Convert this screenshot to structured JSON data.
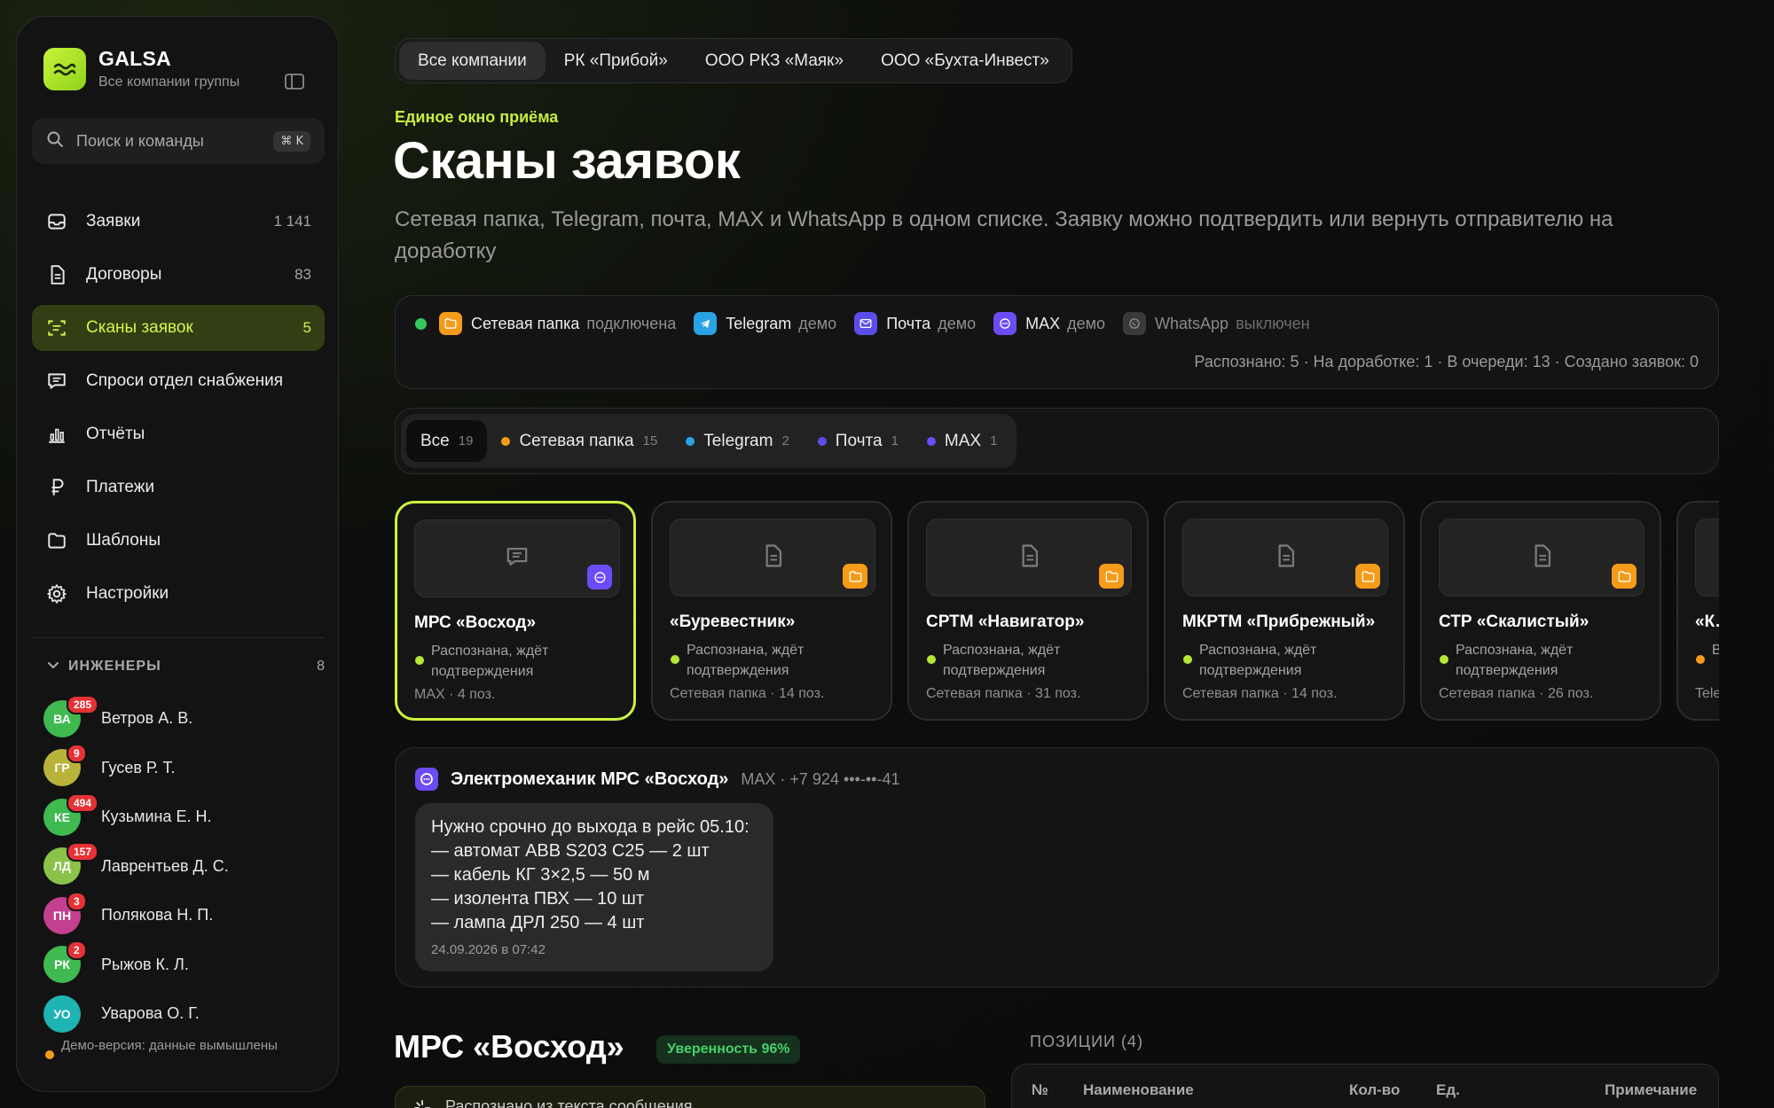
{
  "sidebar": {
    "brand_name": "GALSA",
    "brand_subtitle": "Все компании группы",
    "search_placeholder": "Поиск и команды",
    "search_shortcut": "⌘ K",
    "nav": [
      {
        "label": "Заявки",
        "count": "1 141",
        "icon": "inbox-icon"
      },
      {
        "label": "Договоры",
        "count": "83",
        "icon": "document-icon"
      },
      {
        "label": "Сканы заявок",
        "count": "5",
        "icon": "scan-icon",
        "active": true
      },
      {
        "label": "Спроси отдел снабжения",
        "count": "",
        "icon": "chat-icon"
      },
      {
        "label": "Отчёты",
        "count": "",
        "icon": "bar-chart-icon"
      },
      {
        "label": "Платежи",
        "count": "",
        "icon": "ruble-icon"
      },
      {
        "label": "Шаблоны",
        "count": "",
        "icon": "folder-icon"
      },
      {
        "label": "Настройки",
        "count": "",
        "icon": "gear-icon"
      }
    ],
    "engineers_title": "ИНЖЕНЕРЫ",
    "engineers_count": "8",
    "engineers": [
      {
        "initials": "ВА",
        "name": "Ветров А. В.",
        "badge": "285",
        "color": "#3fb950"
      },
      {
        "initials": "ГР",
        "name": "Гусев Р. Т.",
        "badge": "9",
        "color": "#b9b33a"
      },
      {
        "initials": "КЕ",
        "name": "Кузьмина Е. Н.",
        "badge": "494",
        "color": "#3fb950"
      },
      {
        "initials": "ЛД",
        "name": "Лаврентьев Д. С.",
        "badge": "157",
        "color": "#8bc34a"
      },
      {
        "initials": "ПН",
        "name": "Полякова Н. П.",
        "badge": "3",
        "color": "#c2408f"
      },
      {
        "initials": "РК",
        "name": "Рыжов К. Л.",
        "badge": "2",
        "color": "#3fb950"
      },
      {
        "initials": "УО",
        "name": "Уварова О. Г.",
        "badge": "",
        "color": "#1fb3b3"
      }
    ],
    "demo_note": "Демо-версия: данные вымышлены"
  },
  "company_tabs": [
    "Все компании",
    "РК «Прибой»",
    "ООО РКЗ «Маяк»",
    "ООО «Бухта-Инвест»"
  ],
  "header": {
    "eyebrow": "Единое окно приёма",
    "title": "Сканы заявок",
    "description": "Сетевая папка, Telegram, почта, MAX и WhatsApp в одном списке. Заявку можно подтвердить или вернуть отправителю на доработку"
  },
  "channels": [
    {
      "name": "Сетевая папка",
      "status": "подключена",
      "color": "#f59b1a",
      "icon": "folder-icon"
    },
    {
      "name": "Telegram",
      "status": "демо",
      "color": "#2aa3e6",
      "icon": "telegram-icon"
    },
    {
      "name": "Почта",
      "status": "демо",
      "color": "#5b4ee8",
      "icon": "mail-icon"
    },
    {
      "name": "MAX",
      "status": "демо",
      "color": "#6b4cf6",
      "icon": "max-icon"
    },
    {
      "name": "WhatsApp",
      "status": "выключен",
      "color": "#3a3a3a",
      "icon": "whatsapp-icon",
      "off": true
    }
  ],
  "stats": "Распознано: 5 · На доработке: 1 · В очереди: 13 · Создано заявок: 0",
  "filters": [
    {
      "label": "Все",
      "count": "19",
      "dot": ""
    },
    {
      "label": "Сетевая папка",
      "count": "15",
      "dot": "#f59b1a"
    },
    {
      "label": "Telegram",
      "count": "2",
      "dot": "#2aa3e6"
    },
    {
      "label": "Почта",
      "count": "1",
      "dot": "#5b4ee8"
    },
    {
      "label": "MAX",
      "count": "1",
      "dot": "#6b4cf6"
    }
  ],
  "cards": [
    {
      "title": "МРС «Восход»",
      "status": "Распознана, ждёт подтверждения",
      "meta": "MAX · 4 поз.",
      "thumb_icon": "chat-icon",
      "source_icon": "max-icon",
      "source_color": "#6b4cf6",
      "status_color": "#b5e835",
      "selected": true
    },
    {
      "title": "«Буревестник»",
      "status": "Распознана, ждёт подтверждения",
      "meta": "Сетевая папка · 14 поз.",
      "thumb_icon": "document-icon",
      "source_icon": "folder-icon",
      "source_color": "#f59b1a",
      "status_color": "#b5e835"
    },
    {
      "title": "СРТМ «Навигатор»",
      "status": "Распознана, ждёт подтверждения",
      "meta": "Сетевая папка · 31 поз.",
      "thumb_icon": "document-icon",
      "source_icon": "folder-icon",
      "source_color": "#f59b1a",
      "status_color": "#b5e835"
    },
    {
      "title": "МКРТМ «Прибрежный»",
      "status": "Распознана, ждёт подтверждения",
      "meta": "Сетевая папка · 14 поз.",
      "thumb_icon": "document-icon",
      "source_icon": "folder-icon",
      "source_color": "#f59b1a",
      "status_color": "#b5e835"
    },
    {
      "title": "СТР «Скалистый»",
      "status": "Распознана, ждёт подтверждения",
      "meta": "Сетевая папка · 26 поз.",
      "thumb_icon": "document-icon",
      "source_icon": "folder-icon",
      "source_color": "#f59b1a",
      "status_color": "#b5e835"
    },
    {
      "title": "«К…",
      "status": "В… д…",
      "meta": "Tele…",
      "thumb_icon": "document-icon",
      "source_icon": "",
      "source_color": "",
      "status_color": "#f59b1a"
    }
  ],
  "message": {
    "sender": "Электромеханик МРС «Восход»",
    "meta": "MAX · +7 924 •••-••-41",
    "lines": [
      "Нужно срочно до выхода в рейс 05.10:",
      "— автомат ABB S203 C25 — 2 шт",
      "— кабель КГ 3×2,5 — 50 м",
      "— изолента ПВХ — 10 шт",
      "— лампа ДРЛ 250 — 4 шт"
    ],
    "time": "24.09.2026 в 07:42"
  },
  "detail": {
    "title": "МРС «Восход»",
    "confidence": "Уверенность 96%",
    "recognized_note": "Распознано из текста сообщения",
    "positions_label": "ПОЗИЦИИ (4)",
    "columns": [
      "№",
      "Наименование",
      "Кол-во",
      "Ед.",
      "Примечание"
    ]
  }
}
